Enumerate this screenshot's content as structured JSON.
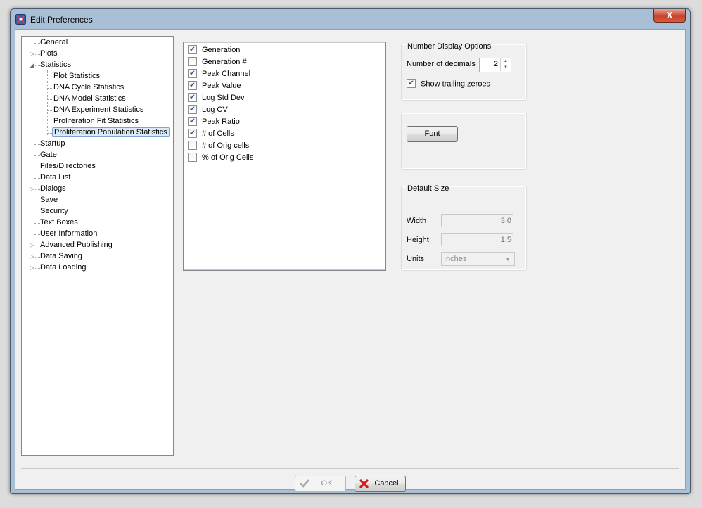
{
  "window": {
    "title": "Edit Preferences",
    "close_label": "X"
  },
  "tree": [
    {
      "label": "General"
    },
    {
      "label": "Plots"
    },
    {
      "label": "Statistics"
    },
    {
      "label": "Plot Statistics"
    },
    {
      "label": "DNA Cycle Statistics"
    },
    {
      "label": "DNA Model Statistics"
    },
    {
      "label": "DNA Experiment Statistics"
    },
    {
      "label": "Proliferation Fit Statistics"
    },
    {
      "label": "Proliferation Population Statistics"
    },
    {
      "label": "Startup"
    },
    {
      "label": "Gate"
    },
    {
      "label": "Files/Directories"
    },
    {
      "label": "Data List"
    },
    {
      "label": "Dialogs"
    },
    {
      "label": "Save"
    },
    {
      "label": "Security"
    },
    {
      "label": "Text Boxes"
    },
    {
      "label": "User Information"
    },
    {
      "label": "Advanced Publishing"
    },
    {
      "label": "Data Saving"
    },
    {
      "label": "Data Loading"
    }
  ],
  "statistics_list": [
    {
      "label": "Generation",
      "checked": true
    },
    {
      "label": "Generation #",
      "checked": false
    },
    {
      "label": "Peak Channel",
      "checked": true
    },
    {
      "label": "Peak Value",
      "checked": true
    },
    {
      "label": "Log Std Dev",
      "checked": true
    },
    {
      "label": "Log CV",
      "checked": true
    },
    {
      "label": "Peak Ratio",
      "checked": true
    },
    {
      "label": "# of Cells",
      "checked": true
    },
    {
      "label": "# of Orig cells",
      "checked": false
    },
    {
      "label": "% of Orig Cells",
      "checked": false
    }
  ],
  "number_display": {
    "title": "Number Display Options",
    "decimals_label": "Number of decimals",
    "decimals_value": "2",
    "trailing_label": "Show trailing zeroes",
    "trailing_checked": true
  },
  "font_button": "Font",
  "default_size": {
    "title": "Default Size",
    "width_label": "Width",
    "width_value": "3.0",
    "height_label": "Height",
    "height_value": "1.5",
    "units_label": "Units",
    "units_value": "Inches"
  },
  "footer": {
    "ok_label": "OK",
    "cancel_label": "Cancel"
  }
}
